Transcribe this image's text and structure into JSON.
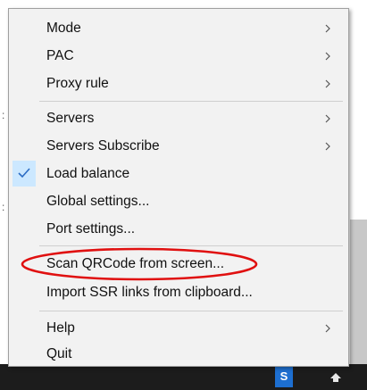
{
  "menu": {
    "items": [
      {
        "label": "Mode",
        "has_submenu": true
      },
      {
        "label": "PAC",
        "has_submenu": true
      },
      {
        "label": "Proxy rule",
        "has_submenu": true
      },
      {
        "label": "Servers",
        "has_submenu": true
      },
      {
        "label": "Servers Subscribe",
        "has_submenu": true
      },
      {
        "label": "Load balance",
        "checked": true
      },
      {
        "label": "Global settings..."
      },
      {
        "label": "Port settings..."
      },
      {
        "label": "Scan QRCode from screen...",
        "annotated": true
      },
      {
        "label": "Import SSR links from clipboard..."
      },
      {
        "label": "Help",
        "has_submenu": true
      },
      {
        "label": "Quit"
      }
    ]
  },
  "taskbar": {
    "app_icon_letter": "S"
  },
  "colors": {
    "menu_bg": "#f2f2f2",
    "check_highlight": "#cce8ff",
    "check_color": "#2b6cc4",
    "annotation_red": "#e01010",
    "taskbar_bg": "#1c1c1c",
    "app_icon_bg": "#1d6fd1"
  }
}
